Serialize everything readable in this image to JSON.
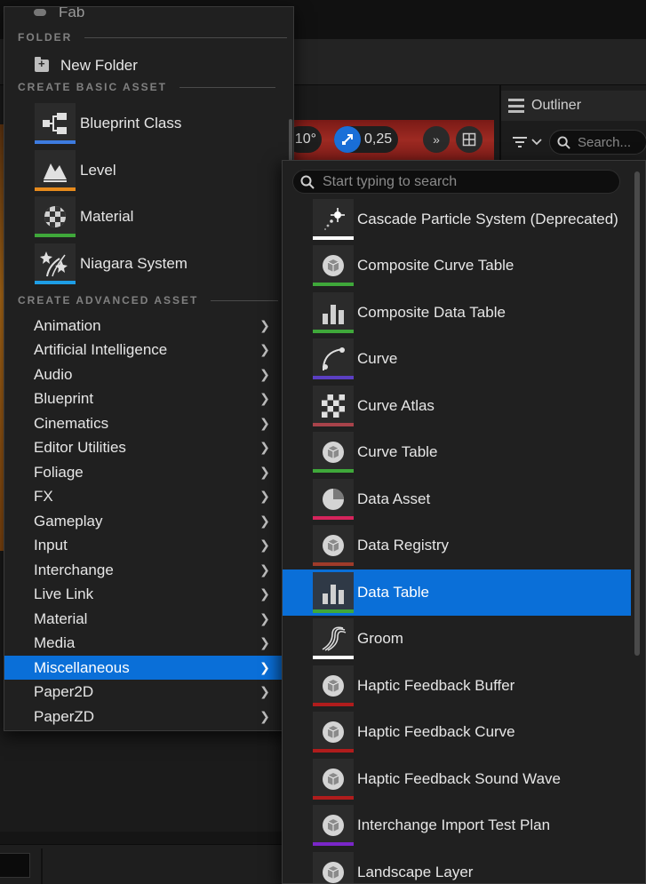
{
  "outliner": {
    "title": "Outliner",
    "search_placeholder": "Search..."
  },
  "viewport": {
    "angle": "10°",
    "scale": "0,25"
  },
  "menu": {
    "partial_top_item": "Fab",
    "folder_header": "FOLDER",
    "new_folder": "New Folder",
    "basic_header": "CREATE BASIC ASSET",
    "basic_items": [
      {
        "label": "Blueprint Class",
        "icon": "blueprint-class-icon",
        "color": "#3d7be0"
      },
      {
        "label": "Level",
        "icon": "level-icon",
        "color": "#e68a1c"
      },
      {
        "label": "Material",
        "icon": "material-icon",
        "color": "#3fa83a"
      },
      {
        "label": "Niagara System",
        "icon": "niagara-system-icon",
        "color": "#1e9ee6"
      }
    ],
    "advanced_header": "CREATE ADVANCED ASSET",
    "advanced_items": [
      {
        "label": "Animation"
      },
      {
        "label": "Artificial Intelligence"
      },
      {
        "label": "Audio"
      },
      {
        "label": "Blueprint"
      },
      {
        "label": "Cinematics"
      },
      {
        "label": "Editor Utilities"
      },
      {
        "label": "Foliage"
      },
      {
        "label": "FX"
      },
      {
        "label": "Gameplay"
      },
      {
        "label": "Input"
      },
      {
        "label": "Interchange"
      },
      {
        "label": "Live Link"
      },
      {
        "label": "Material"
      },
      {
        "label": "Media"
      },
      {
        "label": "Miscellaneous",
        "selected": true
      },
      {
        "label": "Paper2D"
      },
      {
        "label": "PaperZD"
      }
    ]
  },
  "submenu": {
    "search_placeholder": "Start typing to search",
    "items": [
      {
        "label": "Cascade Particle System (Deprecated)",
        "icon": "particle-icon",
        "color": "#ffffff"
      },
      {
        "label": "Composite Curve Table",
        "icon": "asset-sphere-icon",
        "color": "#3fa83a"
      },
      {
        "label": "Composite Data Table",
        "icon": "data-table-icon",
        "color": "#3fa83a"
      },
      {
        "label": "Curve",
        "icon": "curve-icon",
        "color": "#5b3fc2"
      },
      {
        "label": "Curve Atlas",
        "icon": "checker-icon",
        "color": "#a8434a"
      },
      {
        "label": "Curve Table",
        "icon": "asset-sphere-icon",
        "color": "#3fa83a"
      },
      {
        "label": "Data Asset",
        "icon": "pie-icon",
        "color": "#d6245c"
      },
      {
        "label": "Data Registry",
        "icon": "asset-sphere-icon",
        "color": "#9e3b2a"
      },
      {
        "label": "Data Table",
        "icon": "data-table-icon",
        "color": "#3fa83a",
        "selected": true
      },
      {
        "label": "Groom",
        "icon": "groom-icon",
        "color": "#ffffff"
      },
      {
        "label": "Haptic Feedback Buffer",
        "icon": "asset-sphere-icon",
        "color": "#b01c1c"
      },
      {
        "label": "Haptic Feedback Curve",
        "icon": "asset-sphere-icon",
        "color": "#b01c1c"
      },
      {
        "label": "Haptic Feedback Sound Wave",
        "icon": "asset-sphere-icon",
        "color": "#b01c1c"
      },
      {
        "label": "Interchange Import Test Plan",
        "icon": "asset-sphere-icon",
        "color": "#7a26c9"
      },
      {
        "label": "Landscape Layer",
        "icon": "asset-sphere-icon",
        "color": "#888888"
      }
    ]
  }
}
